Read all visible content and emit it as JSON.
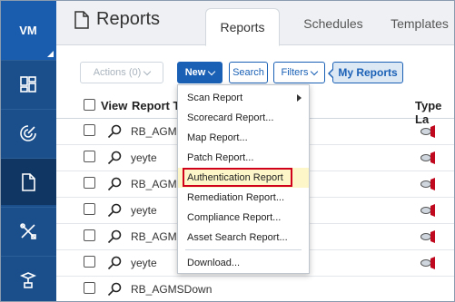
{
  "sidebar": {
    "brand": "VM",
    "items": [
      {
        "icon": "dashboard-icon"
      },
      {
        "icon": "scan-radar-icon"
      },
      {
        "icon": "reports-document-icon",
        "active": true
      },
      {
        "icon": "remediation-tools-icon"
      },
      {
        "icon": "asset-network-icon"
      }
    ]
  },
  "header": {
    "title": "Reports",
    "tabs": [
      "Reports",
      "Schedules",
      "Templates"
    ]
  },
  "toolbar": {
    "actions_label": "Actions (0)",
    "new_label": "New",
    "search_label": "Search",
    "filters_label": "Filters",
    "my_reports_label": "My Reports"
  },
  "table": {
    "headers": {
      "view": "View",
      "title": "Report T",
      "type": "Type La"
    },
    "rows": [
      {
        "name": "RB_AGMS"
      },
      {
        "name": "yeyte"
      },
      {
        "name": "RB_AGM"
      },
      {
        "name": "yeyte"
      },
      {
        "name": "RB_AGM"
      },
      {
        "name": "yeyte"
      },
      {
        "name": "RB_AGMSDown"
      }
    ]
  },
  "new_menu": {
    "items": [
      {
        "label": "Scan Report",
        "submenu": true
      },
      {
        "label": "Scorecard Report..."
      },
      {
        "label": "Map Report..."
      },
      {
        "label": "Patch Report..."
      },
      {
        "label": "Authentication Report",
        "highlighted": true
      },
      {
        "label": "Remediation Report..."
      },
      {
        "label": "Compliance Report..."
      },
      {
        "label": "Asset Search Report..."
      },
      {
        "label": "Download..."
      }
    ]
  },
  "colors": {
    "sidebar": "#1b4f8c",
    "brand": "#1a5cad",
    "accent": "#1a61b6",
    "highlight_bg": "#fdf6c9",
    "highlight_border": "#d0021b"
  }
}
